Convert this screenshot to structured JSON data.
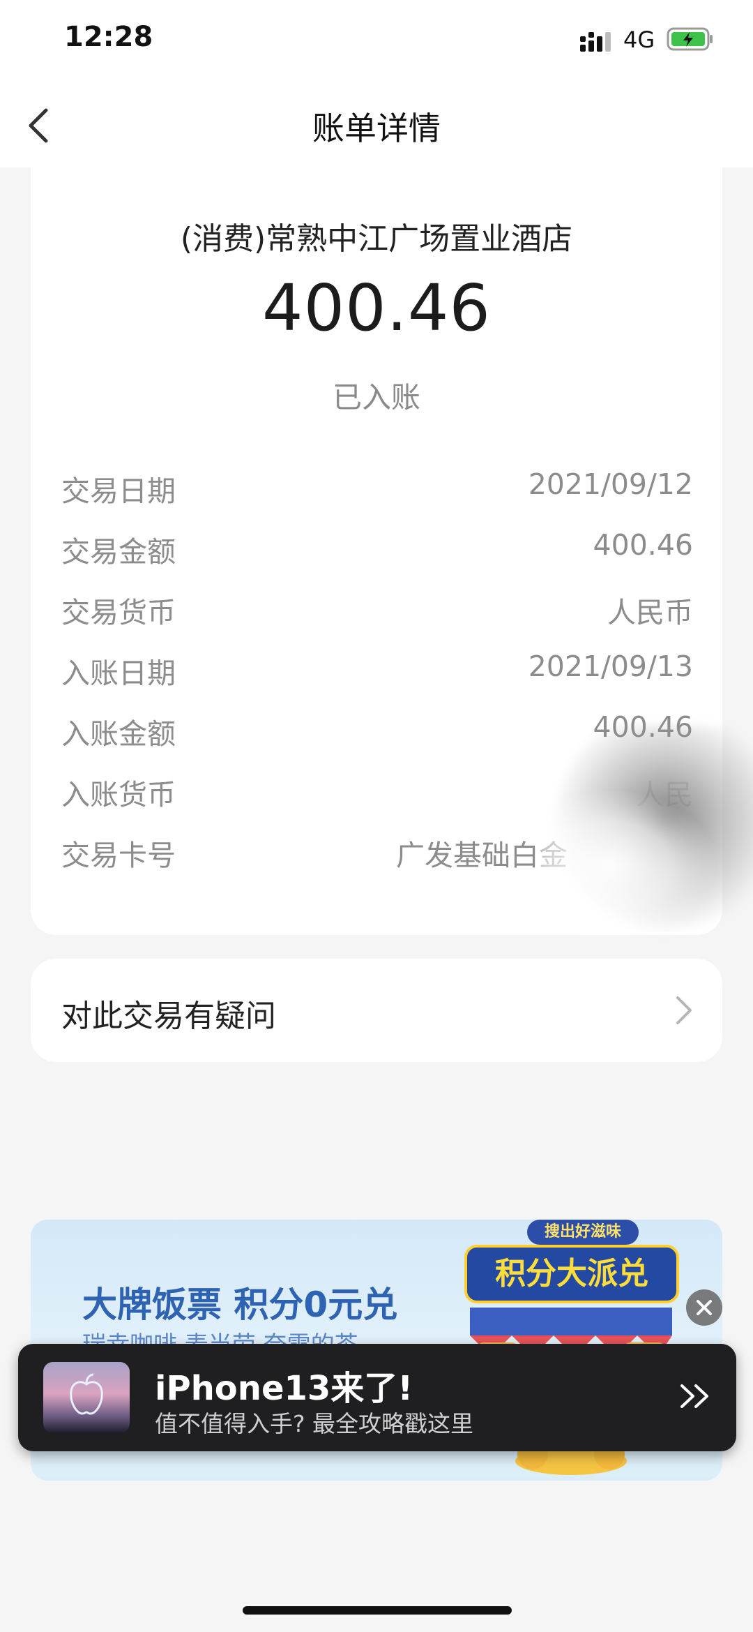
{
  "status_bar": {
    "time": "12:28",
    "network": "4G"
  },
  "nav": {
    "title": "账单详情"
  },
  "detail": {
    "merchant": "(消费)常熟中江广场置业酒店",
    "amount": "400.46",
    "status": "已入账",
    "rows": [
      {
        "label": "交易日期",
        "value": "2021/09/12"
      },
      {
        "label": "交易金额",
        "value": "400.46"
      },
      {
        "label": "交易货币",
        "value": "人民币"
      },
      {
        "label": "入账日期",
        "value": "2021/09/13"
      },
      {
        "label": "入账金额",
        "value": "400.46"
      },
      {
        "label": "入账货币",
        "value": "人民"
      },
      {
        "label": "交易卡号",
        "value": "广发基础白金"
      }
    ]
  },
  "query": {
    "label": "对此交易有疑问"
  },
  "banner": {
    "title": "大牌饭票 积分0元兑",
    "subtitle": "瑞幸咖啡 麦当劳 奈雪的茶",
    "badge_top": "搜出好滋味",
    "badge_main": "积分大派兑"
  },
  "notification": {
    "title": "iPhone13来了!",
    "subtitle": "值不值得入手? 最全攻略戳这里"
  }
}
